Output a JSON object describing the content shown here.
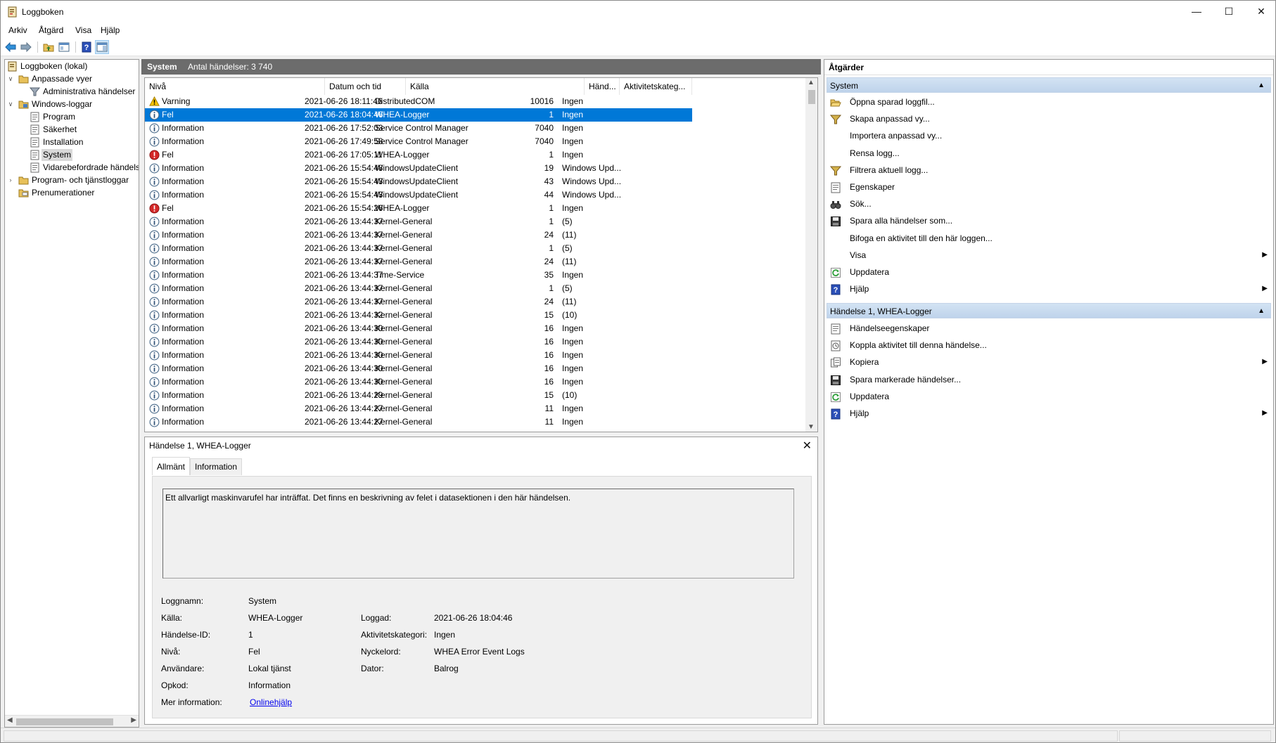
{
  "window": {
    "title": "Loggboken",
    "minimize": "—",
    "maximize": "☐",
    "close": "✕"
  },
  "menu": [
    "Arkiv",
    "Åtgärd",
    "Visa",
    "Hjälp"
  ],
  "tree": [
    {
      "label": "Loggboken (lokal)",
      "icon": "event-viewer-icon"
    },
    {
      "label": "Anpassade vyer",
      "icon": "folder-icon"
    },
    {
      "label": "Administrativa händelser",
      "icon": "filter-icon"
    },
    {
      "label": "Windows-loggar",
      "icon": "folder-icon"
    },
    {
      "label": "Program",
      "icon": "log-icon"
    },
    {
      "label": "Säkerhet",
      "icon": "log-icon"
    },
    {
      "label": "Installation",
      "icon": "log-icon"
    },
    {
      "label": "System",
      "icon": "log-icon"
    },
    {
      "label": "Vidarebefordrade händelser",
      "icon": "log-icon"
    },
    {
      "label": "Program- och tjänstloggar",
      "icon": "folder-icon"
    },
    {
      "label": "Prenumerationer",
      "icon": "subscription-icon"
    }
  ],
  "log": {
    "name": "System",
    "count": "Antal händelser: 3 740"
  },
  "columns": [
    "Nivå",
    "Datum och tid",
    "Källa",
    "Händ...",
    "Aktivitetskateg..."
  ],
  "rows": [
    {
      "level": "Varning",
      "type": "warning",
      "date": "2021-06-26 18:11:46",
      "source": "DistributedCOM",
      "id": "10016",
      "cat": "Ingen"
    },
    {
      "level": "Fel",
      "type": "info",
      "date": "2021-06-26 18:04:46",
      "source": "WHEA-Logger",
      "id": "1",
      "cat": "Ingen",
      "selected": true
    },
    {
      "level": "Information",
      "type": "info",
      "date": "2021-06-26 17:52:03",
      "source": "Service Control Manager",
      "id": "7040",
      "cat": "Ingen"
    },
    {
      "level": "Information",
      "type": "info",
      "date": "2021-06-26 17:49:58",
      "source": "Service Control Manager",
      "id": "7040",
      "cat": "Ingen"
    },
    {
      "level": "Fel",
      "type": "error",
      "date": "2021-06-26 17:05:11",
      "source": "WHEA-Logger",
      "id": "1",
      "cat": "Ingen"
    },
    {
      "level": "Information",
      "type": "info",
      "date": "2021-06-26 15:54:48",
      "source": "WindowsUpdateClient",
      "id": "19",
      "cat": "Windows Upd..."
    },
    {
      "level": "Information",
      "type": "info",
      "date": "2021-06-26 15:54:43",
      "source": "WindowsUpdateClient",
      "id": "43",
      "cat": "Windows Upd..."
    },
    {
      "level": "Information",
      "type": "info",
      "date": "2021-06-26 15:54:43",
      "source": "WindowsUpdateClient",
      "id": "44",
      "cat": "Windows Upd..."
    },
    {
      "level": "Fel",
      "type": "error",
      "date": "2021-06-26 15:54:26",
      "source": "WHEA-Logger",
      "id": "1",
      "cat": "Ingen"
    },
    {
      "level": "Information",
      "type": "info",
      "date": "2021-06-26 13:44:37",
      "source": "Kernel-General",
      "id": "1",
      "cat": "(5)"
    },
    {
      "level": "Information",
      "type": "info",
      "date": "2021-06-26 13:44:37",
      "source": "Kernel-General",
      "id": "24",
      "cat": "(11)"
    },
    {
      "level": "Information",
      "type": "info",
      "date": "2021-06-26 13:44:37",
      "source": "Kernel-General",
      "id": "1",
      "cat": "(5)"
    },
    {
      "level": "Information",
      "type": "info",
      "date": "2021-06-26 13:44:37",
      "source": "Kernel-General",
      "id": "24",
      "cat": "(11)"
    },
    {
      "level": "Information",
      "type": "info",
      "date": "2021-06-26 13:44:37",
      "source": "Time-Service",
      "id": "35",
      "cat": "Ingen"
    },
    {
      "level": "Information",
      "type": "info",
      "date": "2021-06-26 13:44:37",
      "source": "Kernel-General",
      "id": "1",
      "cat": "(5)"
    },
    {
      "level": "Information",
      "type": "info",
      "date": "2021-06-26 13:44:37",
      "source": "Kernel-General",
      "id": "24",
      "cat": "(11)"
    },
    {
      "level": "Information",
      "type": "info",
      "date": "2021-06-26 13:44:32",
      "source": "Kernel-General",
      "id": "15",
      "cat": "(10)"
    },
    {
      "level": "Information",
      "type": "info",
      "date": "2021-06-26 13:44:30",
      "source": "Kernel-General",
      "id": "16",
      "cat": "Ingen"
    },
    {
      "level": "Information",
      "type": "info",
      "date": "2021-06-26 13:44:30",
      "source": "Kernel-General",
      "id": "16",
      "cat": "Ingen"
    },
    {
      "level": "Information",
      "type": "info",
      "date": "2021-06-26 13:44:30",
      "source": "Kernel-General",
      "id": "16",
      "cat": "Ingen"
    },
    {
      "level": "Information",
      "type": "info",
      "date": "2021-06-26 13:44:30",
      "source": "Kernel-General",
      "id": "16",
      "cat": "Ingen"
    },
    {
      "level": "Information",
      "type": "info",
      "date": "2021-06-26 13:44:30",
      "source": "Kernel-General",
      "id": "16",
      "cat": "Ingen"
    },
    {
      "level": "Information",
      "type": "info",
      "date": "2021-06-26 13:44:29",
      "source": "Kernel-General",
      "id": "15",
      "cat": "(10)"
    },
    {
      "level": "Information",
      "type": "info",
      "date": "2021-06-26 13:44:27",
      "source": "Kernel-General",
      "id": "11",
      "cat": "Ingen"
    },
    {
      "level": "Information",
      "type": "info",
      "date": "2021-06-26 13:44:27",
      "source": "Kernel-General",
      "id": "11",
      "cat": "Ingen"
    }
  ],
  "detail": {
    "title": "Händelse 1, WHEA-Logger",
    "close": "✕",
    "tabs": [
      "Allmänt",
      "Information"
    ],
    "description": "Ett allvarligt maskinvarufel har inträffat. Det finns en beskrivning av felet i datasektionen i den här händelsen.",
    "fields": {
      "logname_label": "Loggnamn:",
      "logname": "System",
      "source_label": "Källa:",
      "source": "WHEA-Logger",
      "logged_label": "Loggad:",
      "logged": "2021-06-26 18:04:46",
      "eventid_label": "Händelse-ID:",
      "eventid": "1",
      "taskcat_label": "Aktivitetskategori:",
      "taskcat": "Ingen",
      "level_label": "Nivå:",
      "level": "Fel",
      "keywords_label": "Nyckelord:",
      "keywords": "WHEA Error Event Logs",
      "user_label": "Användare:",
      "user": "Lokal tjänst",
      "computer_label": "Dator:",
      "computer": "Balrog",
      "opcode_label": "Opkod:",
      "opcode": "Information",
      "moreinfo_label": "Mer information:",
      "moreinfo": "Onlinehjälp"
    }
  },
  "actions": {
    "header": "Åtgärder",
    "section1": "System",
    "items1": [
      {
        "label": "Öppna sparad loggfil...",
        "icon": "open-folder-icon"
      },
      {
        "label": "Skapa anpassad vy...",
        "icon": "filter-icon"
      },
      {
        "label": "Importera anpassad vy...",
        "icon": ""
      },
      {
        "label": "Rensa logg...",
        "icon": ""
      },
      {
        "label": "Filtrera aktuell logg...",
        "icon": "filter-icon"
      },
      {
        "label": "Egenskaper",
        "icon": "properties-icon"
      },
      {
        "label": "Sök...",
        "icon": "binoculars-icon"
      },
      {
        "label": "Spara alla händelser som...",
        "icon": "save-icon"
      },
      {
        "label": "Bifoga en aktivitet till den här loggen...",
        "icon": ""
      },
      {
        "label": "Visa",
        "icon": "",
        "submenu": true
      },
      {
        "label": "Uppdatera",
        "icon": "refresh-icon"
      },
      {
        "label": "Hjälp",
        "icon": "help-icon",
        "submenu": true
      }
    ],
    "section2": "Händelse 1, WHEA-Logger",
    "items2": [
      {
        "label": "Händelseegenskaper",
        "icon": "properties-icon"
      },
      {
        "label": "Koppla aktivitet till denna händelse...",
        "icon": "task-icon"
      },
      {
        "label": "Kopiera",
        "icon": "copy-icon",
        "submenu": true
      },
      {
        "label": "Spara markerade händelser...",
        "icon": "save-icon"
      },
      {
        "label": "Uppdatera",
        "icon": "refresh-icon"
      },
      {
        "label": "Hjälp",
        "icon": "help-icon",
        "submenu": true
      }
    ]
  }
}
